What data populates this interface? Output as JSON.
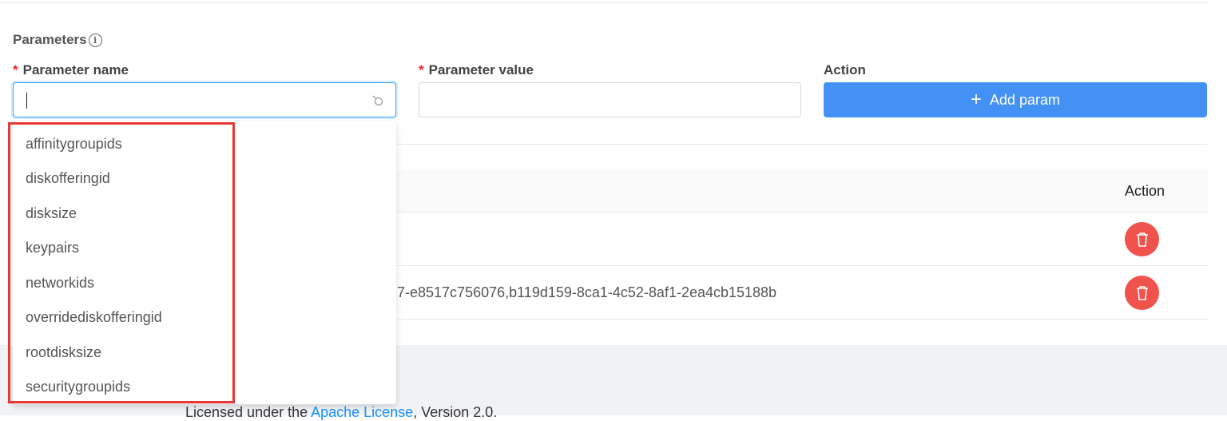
{
  "parameters": {
    "heading": "Parameters",
    "info_icon": "info-circle-icon",
    "name_label": "Parameter name",
    "value_label": "Parameter value",
    "action_label": "Action",
    "required_mark": "*",
    "name_input": {
      "value": "",
      "placeholder": ""
    },
    "value_input": {
      "value": "",
      "placeholder": ""
    },
    "add_button": {
      "icon": "plus-icon",
      "label": "Add param"
    }
  },
  "table": {
    "header_action": "Action",
    "rows": [
      {
        "value": ""
      },
      {
        "value": "7-e8517c756076,b119d159-8ca1-4c52-8af1-2ea4cb15188b"
      }
    ],
    "delete_icon": "trash-icon"
  },
  "dropdown": {
    "options": [
      "affinitygroupids",
      "diskofferingid",
      "disksize",
      "keypairs",
      "networkids",
      "overridediskofferingid",
      "rootdisksize",
      "securitygroupids"
    ]
  },
  "footer": {
    "prefix": "Licensed under the ",
    "link": "Apache License",
    "suffix": ", Version 2.0."
  },
  "colors": {
    "primary": "#4391f5",
    "danger": "#f0534b",
    "highlight": "#e53935",
    "required": "#f5222d"
  }
}
